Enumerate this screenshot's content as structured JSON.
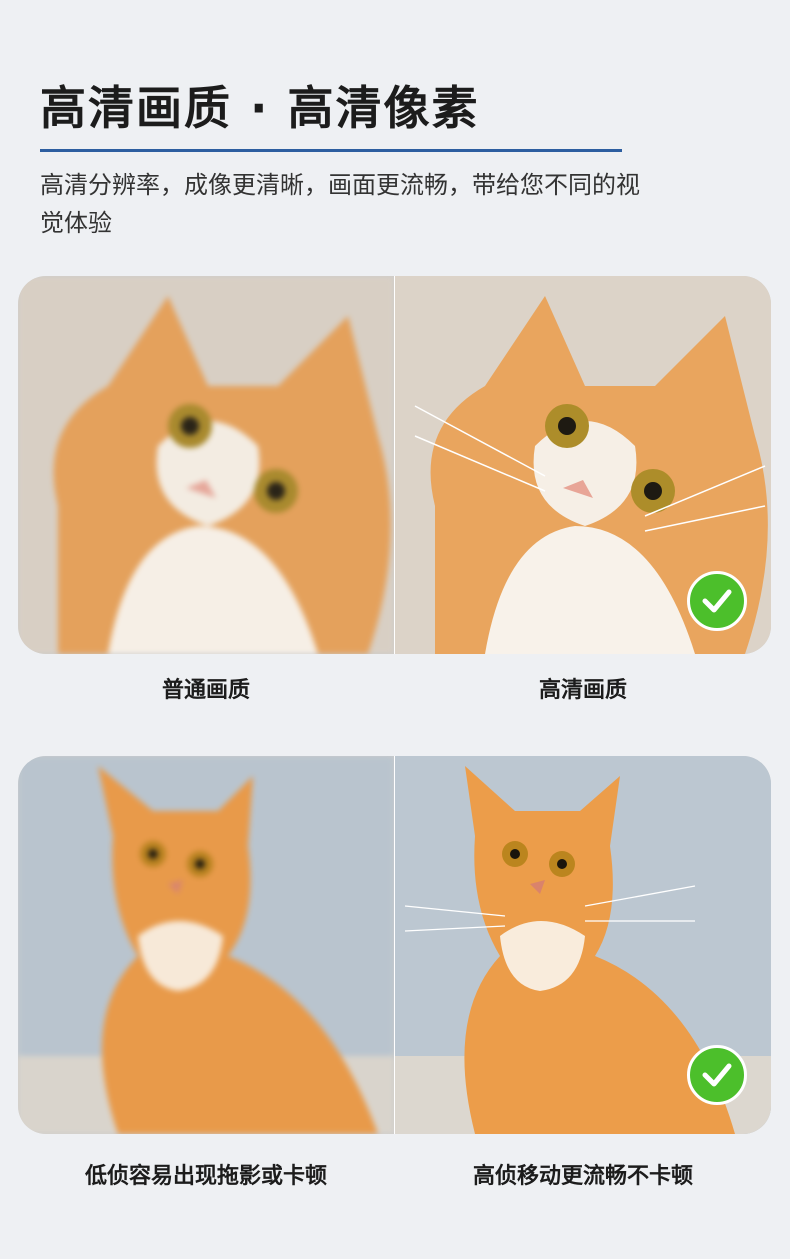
{
  "header": {
    "title": "高清画质 · 高清像素",
    "subtitle": "高清分辨率，成像更清晰，画面更流畅，带给您不同的视觉体验"
  },
  "comparison_1": {
    "left_caption": "普通画质",
    "right_caption": "高清画质"
  },
  "comparison_2": {
    "left_caption": "低侦容易出现拖影或卡顿",
    "right_caption": "高侦移动更流畅不卡顿"
  },
  "colors": {
    "accent": "#2d5ea0",
    "check": "#4cbf2b",
    "background": "#eef0f3"
  },
  "icons": [
    "checkmark-icon"
  ]
}
